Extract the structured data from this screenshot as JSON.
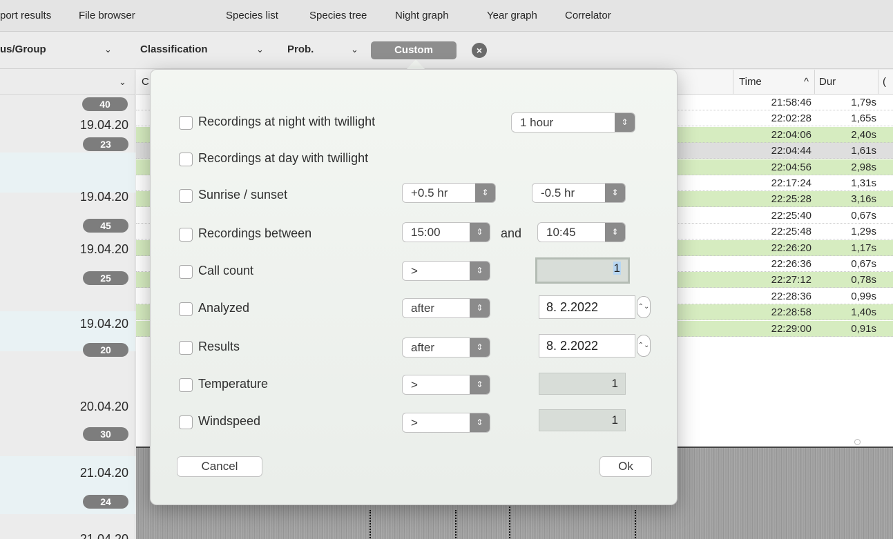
{
  "tabs": [
    "port results",
    "File browser",
    "Species list",
    "Species tree",
    "Night graph",
    "Year graph",
    "Correlator"
  ],
  "filters": {
    "group": "us/Group",
    "classification": "Classification",
    "prob": "Prob.",
    "custom": "Custom"
  },
  "left_list": [
    {
      "date": "",
      "count": "40"
    },
    {
      "date": "19.04.20",
      "count": "23"
    },
    {
      "date": "19.04.20",
      "count": "45"
    },
    {
      "date": "19.04.20",
      "count": "25"
    },
    {
      "date": "19.04.20",
      "count": "20"
    },
    {
      "date": "20.04.20",
      "count": "30"
    },
    {
      "date": "21.04.20",
      "count": "24"
    },
    {
      "date": "21.04.20",
      "count": ""
    }
  ],
  "table": {
    "col_c": "C",
    "col_time": "Time",
    "col_time_sort": "^",
    "col_dur": "Dur",
    "col_extra": "(",
    "rows": [
      {
        "time": "21:58:46",
        "dur": "1,79s",
        "style": "white"
      },
      {
        "time": "22:02:28",
        "dur": "1,65s",
        "style": "white"
      },
      {
        "time": "22:04:06",
        "dur": "2,40s",
        "style": "green"
      },
      {
        "time": "22:04:44",
        "dur": "1,61s",
        "style": "grey"
      },
      {
        "time": "22:04:56",
        "dur": "2,98s",
        "style": "green"
      },
      {
        "time": "22:17:24",
        "dur": "1,31s",
        "style": "white"
      },
      {
        "time": "22:25:28",
        "dur": "3,16s",
        "style": "green"
      },
      {
        "time": "22:25:40",
        "dur": "0,67s",
        "style": "white"
      },
      {
        "time": "22:25:48",
        "dur": "1,29s",
        "style": "white"
      },
      {
        "time": "22:26:20",
        "dur": "1,17s",
        "style": "green"
      },
      {
        "time": "22:26:36",
        "dur": "0,67s",
        "style": "white"
      },
      {
        "time": "22:27:12",
        "dur": "0,78s",
        "style": "green"
      },
      {
        "time": "22:28:36",
        "dur": "0,99s",
        "style": "white"
      },
      {
        "time": "22:28:58",
        "dur": "1,40s",
        "style": "green"
      },
      {
        "time": "22:29:00",
        "dur": "0,91s",
        "style": "green"
      }
    ]
  },
  "dialog": {
    "night_label": "Recordings at night with twillight",
    "night_value": "1 hour",
    "day_label": "Recordings at day with twillight",
    "sun_label": "Sunrise / sunset",
    "sun_value1": "+0.5 hr",
    "sun_value2": "-0.5 hr",
    "between_label": "Recordings between",
    "between_value1": "15:00",
    "between_and": "and",
    "between_value2": "10:45",
    "callcount_label": "Call count",
    "callcount_op": ">",
    "callcount_value": "1",
    "analyzed_label": "Analyzed",
    "analyzed_op": "after",
    "analyzed_date": "8.  2.2022",
    "results_label": "Results",
    "results_op": "after",
    "results_date": "8.  2.2022",
    "temperature_label": "Temperature",
    "temperature_op": ">",
    "temperature_value": "1",
    "windspeed_label": "Windspeed",
    "windspeed_op": ">",
    "windspeed_value": "1",
    "cancel": "Cancel",
    "ok": "Ok"
  }
}
